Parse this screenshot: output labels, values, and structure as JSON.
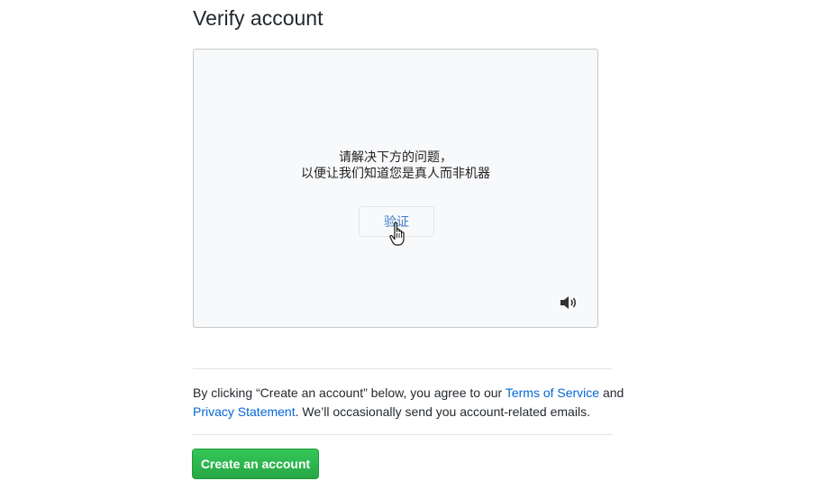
{
  "page": {
    "title": "Verify account"
  },
  "captcha": {
    "prompt_line1": "请解决下方的问题，",
    "prompt_line2": "以便让我们知道您是真人而非机器",
    "verify_label": "验证",
    "audio_icon": "speaker-icon",
    "cursor_icon": "hand-pointer-icon"
  },
  "terms": {
    "text_before": "By clicking “Create an account” below, you agree to our ",
    "terms_link": "Terms of Service",
    "text_middle": " and ",
    "privacy_link": "Privacy Statement",
    "text_after": ". We’ll occasionally send you account-related emails."
  },
  "actions": {
    "create_label": "Create an account"
  },
  "colors": {
    "link": "#0366d6",
    "button_green": "#28a745",
    "verify_text": "#3d7ac8"
  }
}
